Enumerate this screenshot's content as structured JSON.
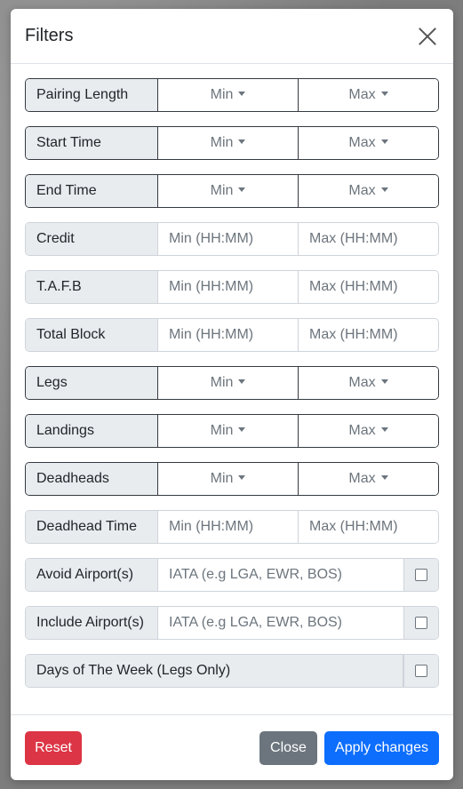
{
  "modal": {
    "title": "Filters"
  },
  "filters": {
    "pairing_length": {
      "label": "Pairing Length",
      "min": "Min",
      "max": "Max"
    },
    "start_time": {
      "label": "Start Time",
      "min": "Min",
      "max": "Max"
    },
    "end_time": {
      "label": "End Time",
      "min": "Min",
      "max": "Max"
    },
    "credit": {
      "label": "Credit",
      "min_placeholder": "Min (HH:MM)",
      "max_placeholder": "Max (HH:MM)"
    },
    "tafb": {
      "label": "T.A.F.B",
      "min_placeholder": "Min (HH:MM)",
      "max_placeholder": "Max (HH:MM)"
    },
    "total_block": {
      "label": "Total Block",
      "min_placeholder": "Min (HH:MM)",
      "max_placeholder": "Max (HH:MM)"
    },
    "legs": {
      "label": "Legs",
      "min": "Min",
      "max": "Max"
    },
    "landings": {
      "label": "Landings",
      "min": "Min",
      "max": "Max"
    },
    "deadheads": {
      "label": "Deadheads",
      "min": "Min",
      "max": "Max"
    },
    "deadhead_time": {
      "label": "Deadhead Time",
      "min_placeholder": "Min (HH:MM)",
      "max_placeholder": "Max (HH:MM)"
    },
    "avoid_airports": {
      "label": "Avoid Airport(s)",
      "placeholder": "IATA (e.g LGA, EWR, BOS)",
      "checked": false
    },
    "include_airports": {
      "label": "Include Airport(s)",
      "placeholder": "IATA (e.g LGA, EWR, BOS)",
      "checked": false
    },
    "days_of_week": {
      "label": "Days of The Week (Legs Only)",
      "checked": false
    }
  },
  "footer": {
    "reset_label": "Reset",
    "close_label": "Close",
    "apply_label": "Apply changes"
  },
  "colors": {
    "reset": "#dc3545",
    "close": "#6c757d",
    "apply": "#0d6efd"
  }
}
